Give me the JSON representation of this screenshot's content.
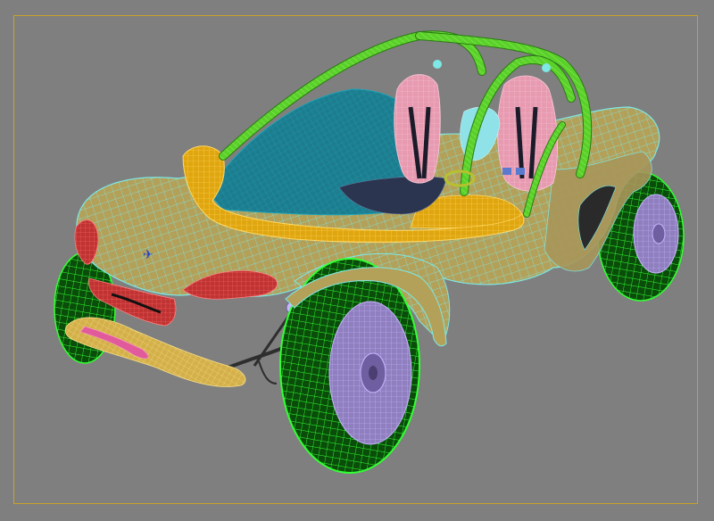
{
  "viewport": {
    "background": "#7f7f7f",
    "frame_color": "#c9a227"
  },
  "model": {
    "colors": {
      "body": "#b3a15a",
      "body_wire": "#7de8e6",
      "tire": "#0a4d0a",
      "tire_wire": "#33ff33",
      "rim": "#8f7fbf",
      "rim_wire": "#c9b6ff",
      "roll_bar": "#5ad12a",
      "windshield": "#1d7d8f",
      "windshield_wire": "#1aa3b8",
      "visor": "#e0a60f",
      "seat": "#e79ab0",
      "headrest_cyan": "#8fe3e8",
      "light_red": "#c03333",
      "grille": "#a11a1a",
      "bumper": "#d4b04a",
      "skid_pink": "#e05a9c",
      "interior": "#6a7aa0",
      "badge": "#2846c8"
    }
  }
}
